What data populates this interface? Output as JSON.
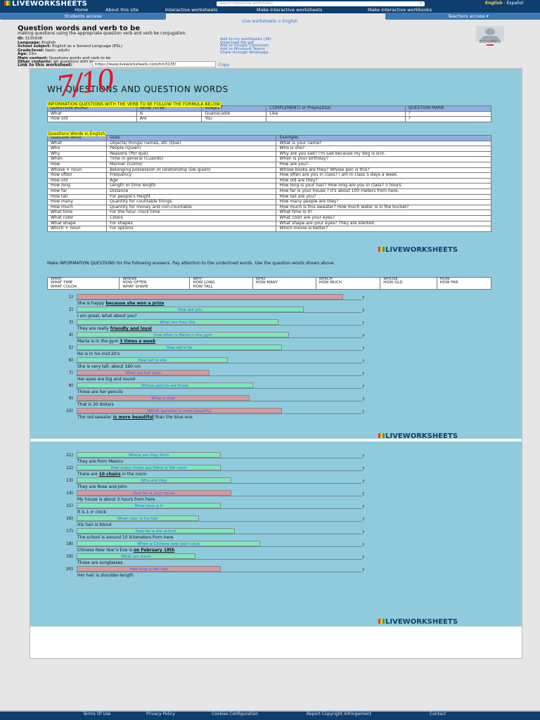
{
  "header": {
    "logo": "LIVEWORKSHEETS",
    "search_placeholder": "Search interactive worksheets",
    "lang_active": "English",
    "lang_sep": " - ",
    "lang_other": "Español",
    "nav": [
      "Home",
      "About this site",
      "Interactive worksheets",
      "Make interactive worksheets",
      "Make interactive workbooks"
    ],
    "students_tab": "Students access",
    "teachers_tab": "Teachers access ▾"
  },
  "breadcrumb": "Live worksheets > English",
  "worksheet": {
    "title": "Question words and verb to be",
    "subtitle": "making questions using the appropriate question verb and verb be conjugation.",
    "info": [
      {
        "k": "ID:",
        "v": " 3135938"
      },
      {
        "k": "Language:",
        "v": " English"
      },
      {
        "k": "School subject:",
        "v": " English as a Second Language (ESL)"
      },
      {
        "k": "Grade/level:",
        "v": " basic, adults"
      },
      {
        "k": "Age:",
        "v": " 19+"
      },
      {
        "k": "Main content:",
        "v": " Questions words and verb to be"
      },
      {
        "k": "Other contents:",
        "v": " wh questions with be"
      }
    ],
    "actions": [
      "Add to my workbooks (39)",
      "Download file pdf",
      "Add to Google Classroom",
      "Add to Microsoft Teams",
      "Share through Whatsapp"
    ],
    "author": "EstelaMary",
    "link_label": "Link to this worksheet:",
    "link_value": "https://www.liveworksheets.com/hm3135!",
    "copy": "Copy"
  },
  "sheet": {
    "score": "7/10",
    "heading": "WH QUESTIONS AND QUESTION WORDS",
    "formula_note": "INFORMATION QUESTIONS WITH THE VERB TO BE FOLLOW THE FORMULA BELOW",
    "t1": {
      "headers": [
        "QUESTION WORD",
        "VERB TO BE",
        "SUBJECT",
        "COMPLEMENT/ or Preposition",
        "QUESTION MARK"
      ],
      "rows": [
        [
          "What",
          "Is",
          "Guanacaste",
          "Like",
          "?"
        ],
        [
          "How old",
          "Are",
          "You",
          "",
          "?"
        ]
      ]
    },
    "t2_label": "Questions Words in English",
    "t2": {
      "headers": [
        "Question word",
        "Uses",
        "Example:"
      ],
      "rows": [
        [
          "What",
          "Objects/ things/ names, etc (Qué)",
          "What is your name?"
        ],
        [
          "Who",
          "People  (Quién)",
          "Who is she?"
        ],
        [
          "Why",
          "Reasons (Por qué)",
          "Why are you sad? I'm sad because my dog is sick."
        ],
        [
          "When",
          "Time in general (Cuando)",
          "When is your birthday?"
        ],
        [
          "How",
          "Manner (Cómo)",
          "How are you?-"
        ],
        [
          "Whose + noun",
          "Belonging possession or relationship (De quién)",
          "Whose books are they? Whose pen is this?"
        ],
        [
          "How often",
          "Frequency",
          "How often are you in class? I am in class 5 days a week."
        ],
        [
          "How old",
          "Age",
          "How old are they?"
        ],
        [
          "How long",
          "Length or time length",
          "How long is your hair? How long are you in class? 3 hours."
        ],
        [
          "How far",
          "Distance",
          "How far is your house ?  it's about 100 meters from here."
        ],
        [
          "How tall",
          "For people's Height",
          "How tall are you?"
        ],
        [
          "How many",
          "Quantity for countable things",
          "How many people are they?"
        ],
        [
          "How much",
          "Quantity for money and non-countable",
          "How much is this sweater? How much water is in the bucket?"
        ],
        [
          "What time",
          "For the hour- clock time",
          "What time is it?"
        ],
        [
          "What color",
          "Colors",
          "What color are your eyes?"
        ],
        [
          "What shape",
          "For shapes",
          "What shape are your eyes? They are slanted."
        ],
        [
          "Which + noun",
          "For options",
          "Which movie is better?"
        ]
      ]
    },
    "brand": "LIVEWORKSHEETS",
    "instructions": "Make INFORMATION QUESTIONS for the following answers.  Pay attention to the underlined words.  Use the question words shown above.",
    "words": [
      [
        "WHAT",
        "WHERE",
        "WHY",
        "WHO",
        "WHICH",
        "WHOSE",
        "HOW"
      ],
      [
        "WHAT TIME",
        "HOW OFTEN",
        "HOW LONG",
        "HOW MANY",
        "HOW MUCH",
        "HOW OLD",
        "HOW FAR"
      ],
      [
        "WHAT COLOR",
        "WHAT SHAPE",
        "HOW TALL",
        "",
        "",
        "",
        ""
      ]
    ],
    "items": [
      {
        "n": "1)",
        "answer": "",
        "status": "wrong",
        "fill": 0.74,
        "s": [
          "She is happy ",
          "because she won a prize",
          ""
        ]
      },
      {
        "n": "2)",
        "answer": "How are you",
        "status": "correct",
        "fill": 0.63,
        "s": [
          "I am great, what about you?",
          "",
          ""
        ]
      },
      {
        "n": "3)",
        "answer": "What are they like",
        "status": "correct",
        "fill": 0.56,
        "s": [
          "They are really ",
          "friendly and loyal",
          ""
        ]
      },
      {
        "n": "4)",
        "answer": "How often is Marta in the gym",
        "status": "correct",
        "fill": 0.59,
        "s": [
          "Marta is in the gym ",
          "3 times a week",
          ""
        ]
      },
      {
        "n": "5)",
        "answer": "How old is he",
        "status": "correct",
        "fill": 0.57,
        "s": [
          "He is in his mid 20's",
          "",
          ""
        ]
      },
      {
        "n": "6)",
        "answer": "How tall is she",
        "status": "correct",
        "fill": 0.42,
        "s": [
          "She is very tall, about 160 cm",
          "",
          ""
        ]
      },
      {
        "n": "7)",
        "answer": "What are her eyes",
        "status": "wrong",
        "fill": 0.37,
        "s": [
          "Her eyes are big and round",
          "",
          ""
        ]
      },
      {
        "n": "8)",
        "answer": "Whose pencils are those",
        "status": "correct",
        "fill": 0.49,
        "s": [
          "Those are her pencils",
          "",
          ""
        ]
      },
      {
        "n": "9)",
        "answer": "What is that",
        "status": "wrong",
        "fill": 0.48,
        "s": [
          "That is 20 dollars",
          "",
          ""
        ]
      },
      {
        "n": "10)",
        "answer": "Which question is more beautiful",
        "status": "wrong",
        "fill": 0.57,
        "s": [
          "The red sweater ",
          "is more beautiful",
          " than the blue one."
        ]
      },
      {
        "n": "11)",
        "answer": "Where are they from",
        "status": "correct",
        "fill": 0.4,
        "s": [
          "They are from Mexico",
          "",
          ""
        ]
      },
      {
        "n": "12)",
        "answer": "How many chairs are there in the room",
        "status": "correct",
        "fill": 0.4,
        "s": [
          "There are ",
          "10 chairs",
          " in the room"
        ]
      },
      {
        "n": "13)",
        "answer": "Who are they",
        "status": "correct",
        "fill": 0.43,
        "s": [
          "They are Rose and John",
          "",
          ""
        ]
      },
      {
        "n": "14)",
        "answer": "How far is your house",
        "status": "wrong",
        "fill": 0.43,
        "s": [
          "My house is about 3 hours from here",
          "",
          ""
        ]
      },
      {
        "n": "15)",
        "answer": "What time is it",
        "status": "correct",
        "fill": 0.4,
        "s": [
          "It is 1 o' clock",
          "",
          ""
        ]
      },
      {
        "n": "16)",
        "answer": "What color is his hair",
        "status": "correct",
        "fill": 0.34,
        "s": [
          "His hair is blond",
          "",
          ""
        ]
      },
      {
        "n": "17)",
        "answer": "How far is the school",
        "status": "correct",
        "fill": 0.44,
        "s": [
          "The school is around 10 kilometers from here",
          "",
          ""
        ]
      },
      {
        "n": "18)",
        "answer": "When is Chinese new year's eve",
        "status": "correct",
        "fill": 0.51,
        "s": [
          "Chinese New Year's Eve is ",
          "on February 18th",
          ""
        ]
      },
      {
        "n": "19)",
        "answer": "What are those",
        "status": "correct",
        "fill": 0.33,
        "s": [
          "Those are sunglasses",
          "",
          ""
        ]
      },
      {
        "n": "20)",
        "answer": "How long is her hair",
        "status": "wrong",
        "fill": 0.4,
        "s": [
          "Her hair is shoulder-length",
          "",
          ""
        ]
      }
    ],
    "qmark": "?"
  },
  "footer": [
    "Terms Of Use",
    "Privacy Policy",
    "Cookies Configuration",
    "Report Copyright Infringement",
    "Contact"
  ],
  "colors": {
    "correct": "#80e6bb",
    "wrong": "#d49aa1",
    "navy": "#0e3e6e",
    "sheet": "#90cbdd"
  }
}
